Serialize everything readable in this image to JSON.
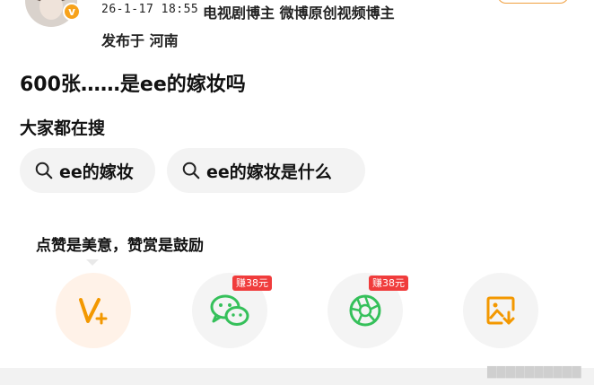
{
  "post": {
    "timestamp": "26-1-17 18:55",
    "author_tags": "电视剧博主 微博原创视频博主",
    "location": "发布于 河南",
    "verified_badge": "v",
    "title": "600张……是ee的嫁妆吗"
  },
  "search": {
    "heading": "大家都在搜",
    "suggestions": [
      {
        "label": "ee的嫁妆"
      },
      {
        "label": "ee的嫁妆是什么"
      }
    ]
  },
  "reward": {
    "tip_text": "点赞是美意，赞赏是鼓励",
    "actions": [
      {
        "icon": "reward-v-plus-icon",
        "badge": ""
      },
      {
        "icon": "wechat-icon",
        "badge": "赚38元"
      },
      {
        "icon": "moments-icon",
        "badge": "赚38元"
      },
      {
        "icon": "save-image-icon",
        "badge": ""
      }
    ]
  },
  "colors": {
    "brand_orange": "#f39800",
    "wechat_green": "#35c05a",
    "badge_red": "#f03c3c",
    "chip_bg": "#f3f3f3"
  },
  "watermark": "▇▇▇▇▇▇▇▇▇▇"
}
